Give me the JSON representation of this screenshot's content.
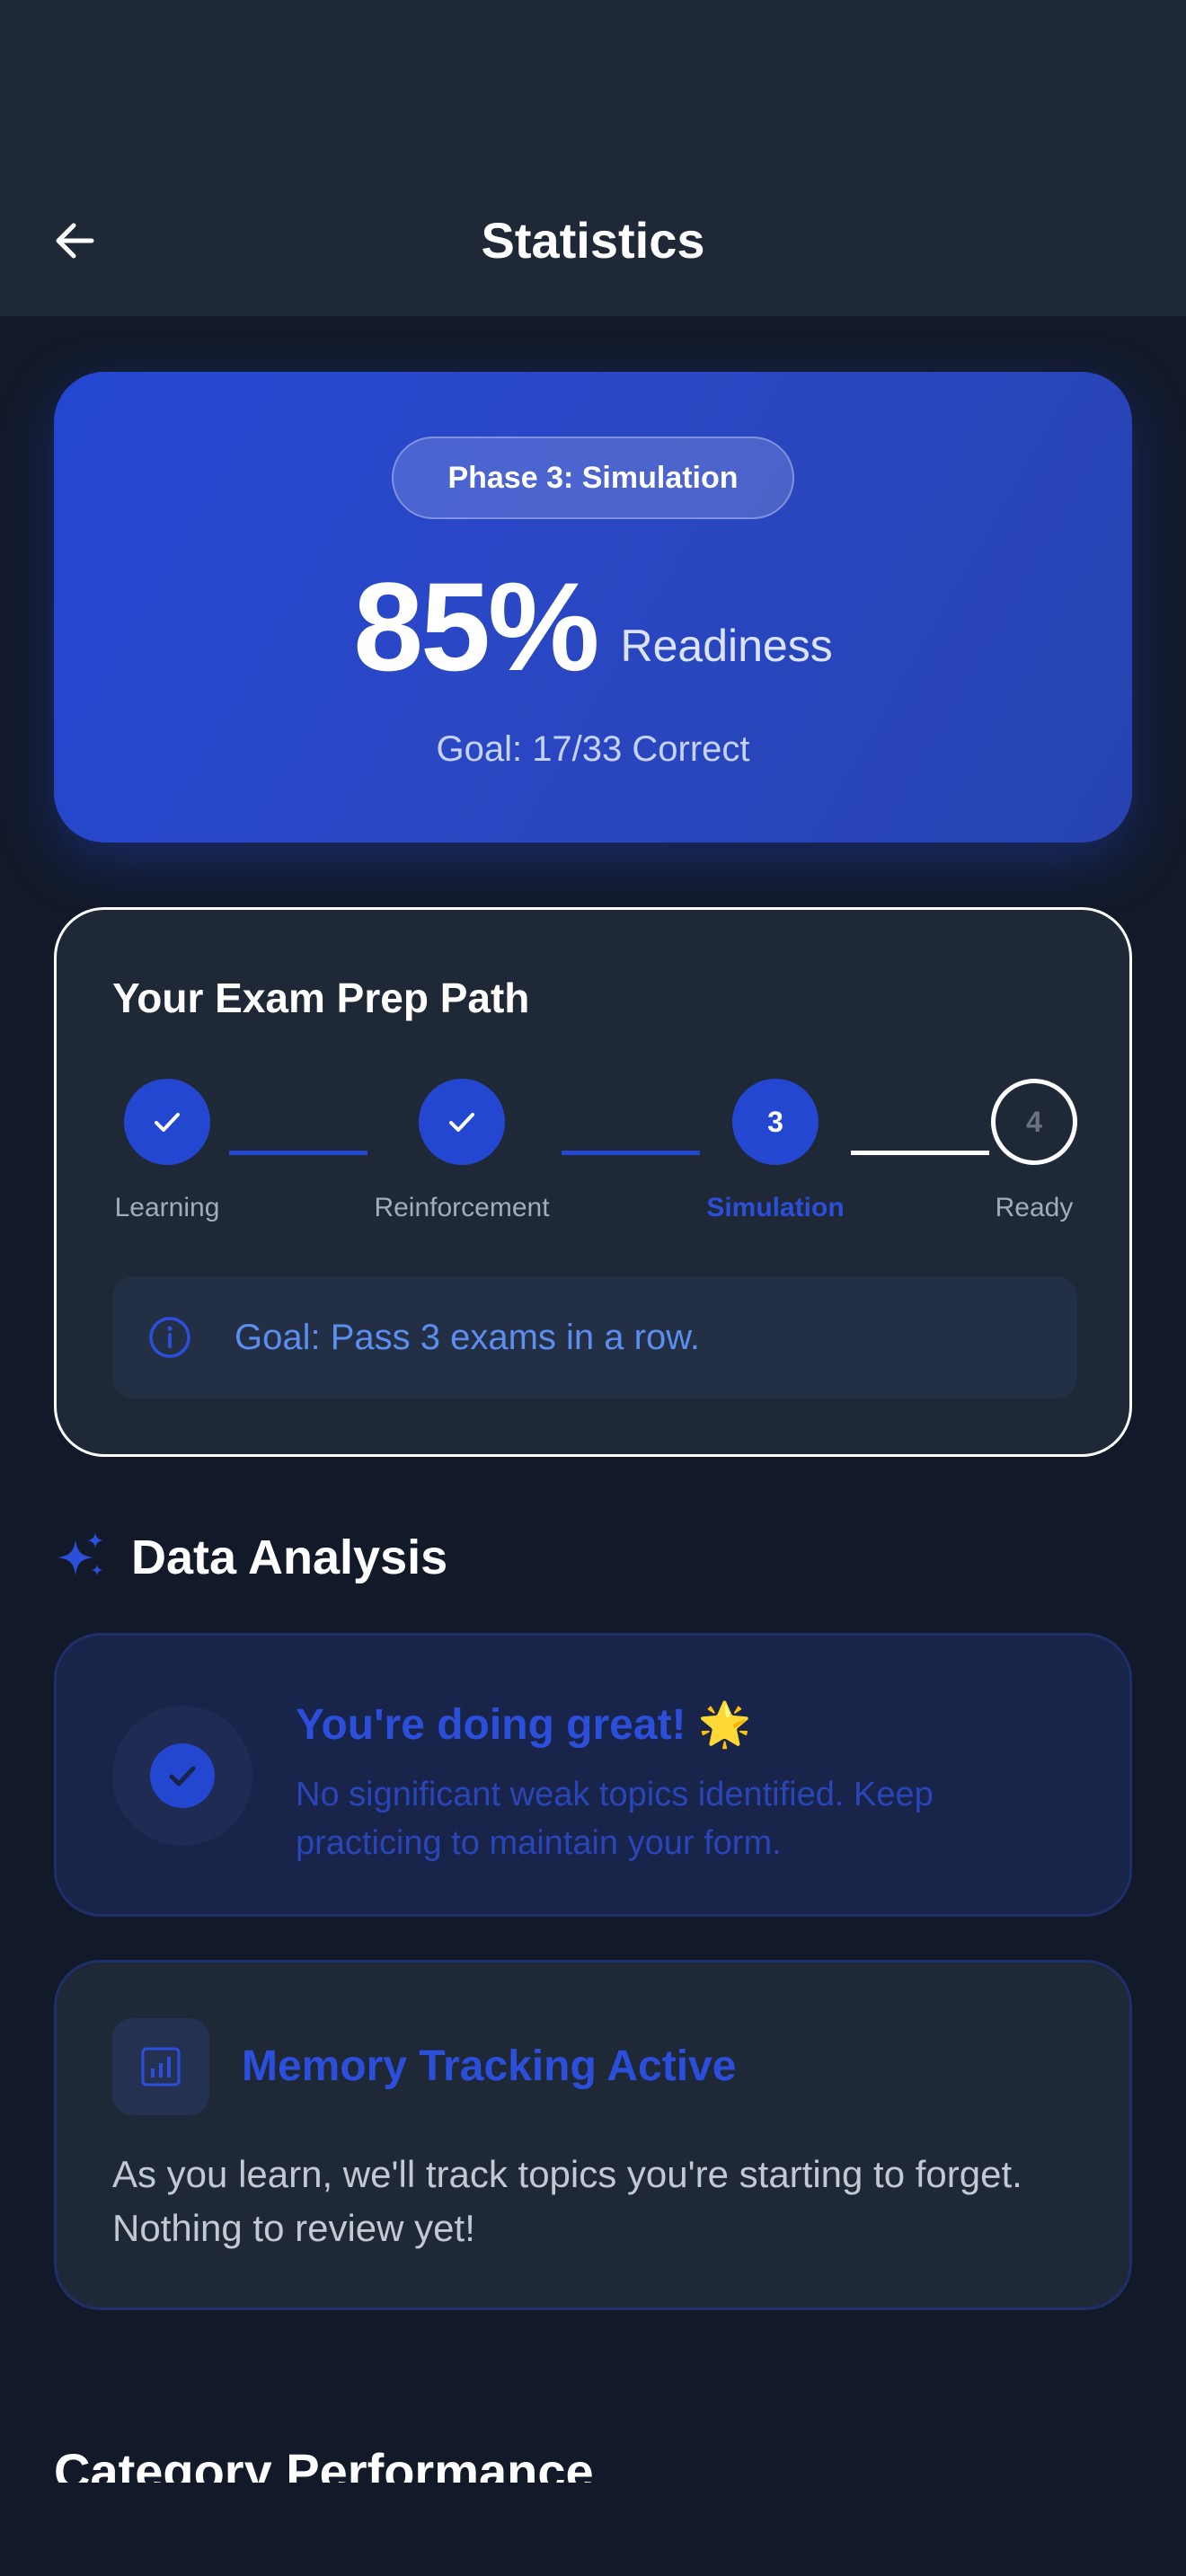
{
  "header": {
    "title": "Statistics",
    "back_icon": "arrow-left-icon"
  },
  "hero": {
    "phase_badge": "Phase 3: Simulation",
    "readiness_value": "85%",
    "readiness_percent": 85,
    "readiness_label": "Readiness",
    "goal": "Goal: 17/33 Correct"
  },
  "prep_path": {
    "title": "Your Exam Prep Path",
    "steps": [
      {
        "label": "Learning",
        "state": "completed",
        "marker": ""
      },
      {
        "label": "Reinforcement",
        "state": "completed",
        "marker": ""
      },
      {
        "label": "Simulation",
        "state": "active",
        "marker": "3"
      },
      {
        "label": "Ready",
        "state": "upcoming",
        "marker": "4"
      }
    ],
    "info": "Goal: Pass 3 exams in a row."
  },
  "data_analysis": {
    "title": "Data Analysis",
    "great": {
      "title": "You're doing great! 🌟",
      "description": "No significant weak topics identified. Keep practicing to maintain your form."
    },
    "memory": {
      "title": "Memory Tracking Active",
      "description": "As you learn, we'll track topics you're starting to forget. Nothing to review yet!"
    }
  },
  "category_performance": {
    "title": "Category Performance"
  },
  "colors": {
    "accent": "#2447d2",
    "background": "#121a2a",
    "card": "#1f2836",
    "info_text": "#5b8ef0"
  }
}
